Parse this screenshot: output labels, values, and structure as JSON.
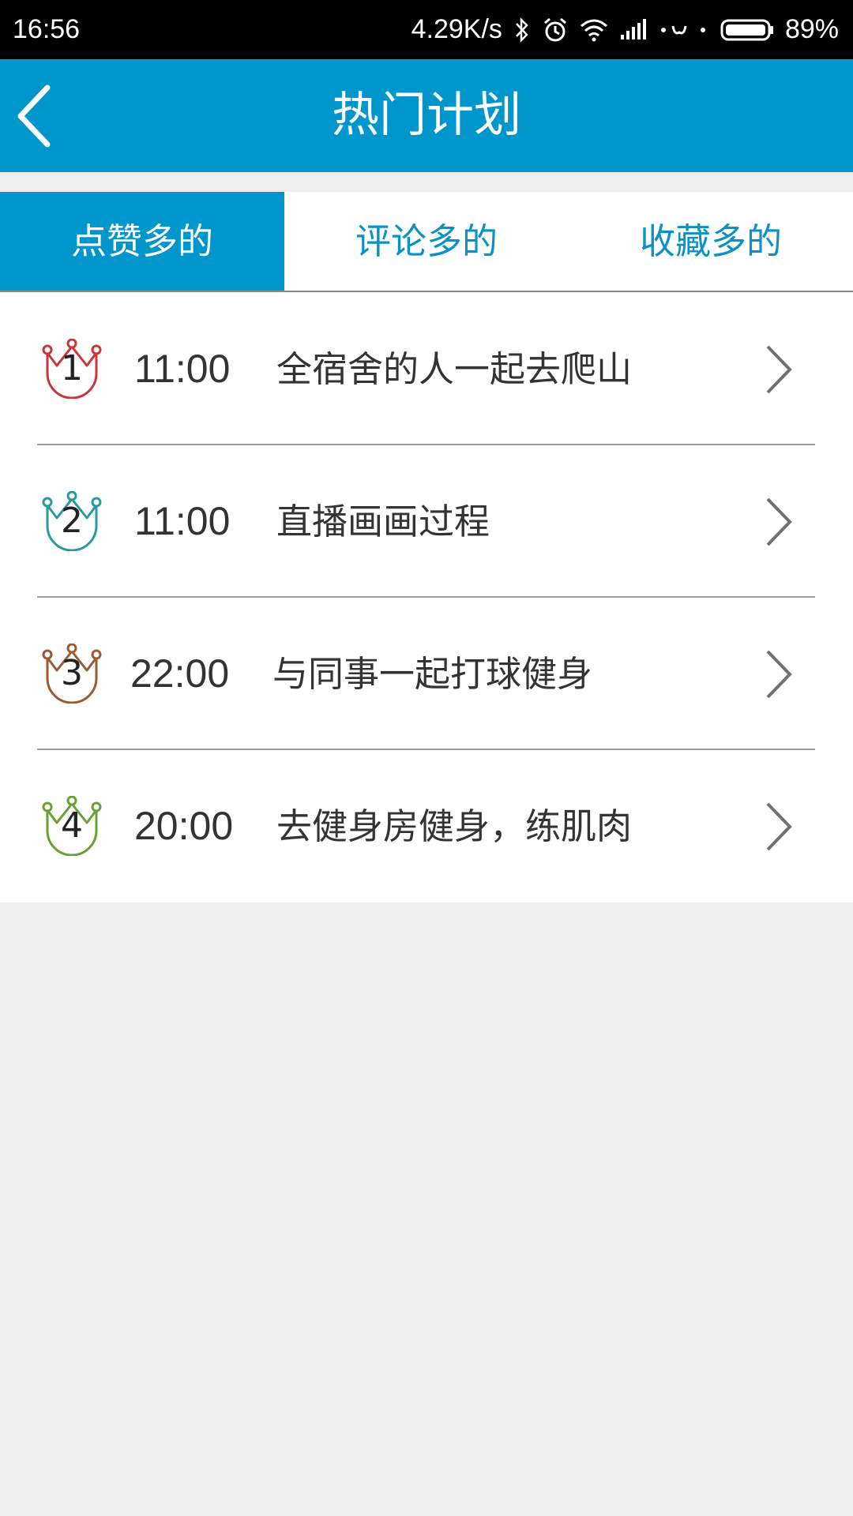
{
  "status_bar": {
    "time": "16:56",
    "speed": "4.29K/s",
    "battery": "89%",
    "icons": [
      "bluetooth-icon",
      "alarm-icon",
      "wifi-icon",
      "signal-icon",
      "dots-icon",
      "battery-icon"
    ]
  },
  "header": {
    "title": "热门计划",
    "back_icon": "back-arrow-icon"
  },
  "tabs": [
    {
      "label": "点赞多的",
      "active": true
    },
    {
      "label": "评论多的",
      "active": false
    },
    {
      "label": "收藏多的",
      "active": false
    }
  ],
  "plans": [
    {
      "rank": "1",
      "time": "11:00",
      "title": "全宿舍的人一起去爬山",
      "crown_color": "#c9363a"
    },
    {
      "rank": "2",
      "time": "11:00",
      "title": "直播画画过程",
      "crown_color": "#2a9a9c"
    },
    {
      "rank": "3",
      "time": "22:00",
      "title": "与同事一起打球健身",
      "crown_color": "#9a5a32"
    },
    {
      "rank": "4",
      "time": "20:00",
      "title": "去健身房健身，练肌肉",
      "crown_color": "#6aa032"
    }
  ],
  "colors": {
    "accent": "#0096cc",
    "background": "#ededed"
  }
}
